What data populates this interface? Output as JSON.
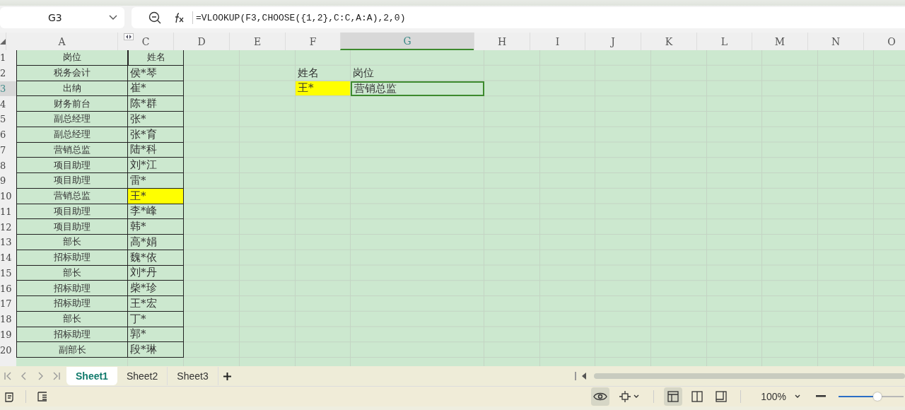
{
  "name_box": {
    "value": "G3"
  },
  "formula_bar": {
    "formula": "=VLOOKUP(F3,CHOOSE({1,2},C:C,A:A),2,0)"
  },
  "columns": [
    {
      "label": "A",
      "selected": false
    },
    {
      "label": "C",
      "selected": false
    },
    {
      "label": "D",
      "selected": false
    },
    {
      "label": "E",
      "selected": false
    },
    {
      "label": "F",
      "selected": false
    },
    {
      "label": "G",
      "selected": true
    },
    {
      "label": "H",
      "selected": false
    },
    {
      "label": "I",
      "selected": false
    },
    {
      "label": "J",
      "selected": false
    },
    {
      "label": "K",
      "selected": false
    },
    {
      "label": "L",
      "selected": false
    },
    {
      "label": "M",
      "selected": false
    },
    {
      "label": "N",
      "selected": false
    },
    {
      "label": "O",
      "selected": false
    }
  ],
  "rows": [
    {
      "number": "1",
      "selected": false,
      "cells": [
        {
          "text": "岗位",
          "kind": "table-center",
          "highlight": false,
          "selected": false
        },
        {
          "text": "姓名",
          "kind": "table-center",
          "highlight": false,
          "selected": false
        }
      ]
    },
    {
      "number": "2",
      "selected": false,
      "cells": [
        {
          "text": "税务会计",
          "kind": "table-center",
          "highlight": false,
          "selected": false
        },
        {
          "text": "侯*琴",
          "kind": "table-left",
          "highlight": false,
          "selected": false
        },
        {},
        {},
        {
          "text": "姓名",
          "kind": "plain",
          "highlight": false,
          "selected": false
        },
        {
          "text": "岗位",
          "kind": "plain",
          "highlight": false,
          "selected": false
        }
      ]
    },
    {
      "number": "3",
      "selected": true,
      "cells": [
        {
          "text": "出纳",
          "kind": "table-center",
          "highlight": false,
          "selected": false
        },
        {
          "text": "崔*",
          "kind": "table-left",
          "highlight": false,
          "selected": false
        },
        {},
        {},
        {
          "text": "王*",
          "kind": "plain",
          "highlight": true,
          "selected": false
        },
        {
          "text": "营销总监",
          "kind": "plain",
          "highlight": false,
          "selected": true
        }
      ]
    },
    {
      "number": "4",
      "selected": false,
      "cells": [
        {
          "text": "财务前台",
          "kind": "table-center",
          "highlight": false,
          "selected": false
        },
        {
          "text": "陈*群",
          "kind": "table-left",
          "highlight": false,
          "selected": false
        }
      ]
    },
    {
      "number": "5",
      "selected": false,
      "cells": [
        {
          "text": "副总经理",
          "kind": "table-center",
          "highlight": false,
          "selected": false
        },
        {
          "text": "张*",
          "kind": "table-left",
          "highlight": false,
          "selected": false
        }
      ]
    },
    {
      "number": "6",
      "selected": false,
      "cells": [
        {
          "text": "副总经理",
          "kind": "table-center",
          "highlight": false,
          "selected": false
        },
        {
          "text": "张*育",
          "kind": "table-left",
          "highlight": false,
          "selected": false
        }
      ]
    },
    {
      "number": "7",
      "selected": false,
      "cells": [
        {
          "text": "营销总监",
          "kind": "table-center",
          "highlight": false,
          "selected": false
        },
        {
          "text": "陆*科",
          "kind": "table-left",
          "highlight": false,
          "selected": false
        }
      ]
    },
    {
      "number": "8",
      "selected": false,
      "cells": [
        {
          "text": "项目助理",
          "kind": "table-center",
          "highlight": false,
          "selected": false
        },
        {
          "text": "刘*江",
          "kind": "table-left",
          "highlight": false,
          "selected": false
        }
      ]
    },
    {
      "number": "9",
      "selected": false,
      "cells": [
        {
          "text": "项目助理",
          "kind": "table-center",
          "highlight": false,
          "selected": false
        },
        {
          "text": "雷*",
          "kind": "table-left",
          "highlight": false,
          "selected": false
        }
      ]
    },
    {
      "number": "10",
      "selected": false,
      "cells": [
        {
          "text": "营销总监",
          "kind": "table-center",
          "highlight": false,
          "selected": false
        },
        {
          "text": "王*",
          "kind": "table-left",
          "highlight": true,
          "selected": false
        }
      ]
    },
    {
      "number": "11",
      "selected": false,
      "cells": [
        {
          "text": "项目助理",
          "kind": "table-center",
          "highlight": false,
          "selected": false
        },
        {
          "text": "李*峰",
          "kind": "table-left",
          "highlight": false,
          "selected": false
        }
      ]
    },
    {
      "number": "12",
      "selected": false,
      "cells": [
        {
          "text": "项目助理",
          "kind": "table-center",
          "highlight": false,
          "selected": false
        },
        {
          "text": "韩*",
          "kind": "table-left",
          "highlight": false,
          "selected": false
        }
      ]
    },
    {
      "number": "13",
      "selected": false,
      "cells": [
        {
          "text": "部长",
          "kind": "table-center",
          "highlight": false,
          "selected": false
        },
        {
          "text": "高*娟",
          "kind": "table-left",
          "highlight": false,
          "selected": false
        }
      ]
    },
    {
      "number": "14",
      "selected": false,
      "cells": [
        {
          "text": "招标助理",
          "kind": "table-center",
          "highlight": false,
          "selected": false
        },
        {
          "text": "魏*依",
          "kind": "table-left",
          "highlight": false,
          "selected": false
        }
      ]
    },
    {
      "number": "15",
      "selected": false,
      "cells": [
        {
          "text": "部长",
          "kind": "table-center",
          "highlight": false,
          "selected": false
        },
        {
          "text": "刘*丹",
          "kind": "table-left",
          "highlight": false,
          "selected": false
        }
      ]
    },
    {
      "number": "16",
      "selected": false,
      "cells": [
        {
          "text": "招标助理",
          "kind": "table-center",
          "highlight": false,
          "selected": false
        },
        {
          "text": "柴*珍",
          "kind": "table-left",
          "highlight": false,
          "selected": false
        }
      ]
    },
    {
      "number": "17",
      "selected": false,
      "cells": [
        {
          "text": "招标助理",
          "kind": "table-center",
          "highlight": false,
          "selected": false
        },
        {
          "text": "王*宏",
          "kind": "table-left",
          "highlight": false,
          "selected": false
        }
      ]
    },
    {
      "number": "18",
      "selected": false,
      "cells": [
        {
          "text": "部长",
          "kind": "table-center",
          "highlight": false,
          "selected": false
        },
        {
          "text": "丁*",
          "kind": "table-left",
          "highlight": false,
          "selected": false
        }
      ]
    },
    {
      "number": "19",
      "selected": false,
      "cells": [
        {
          "text": "招标助理",
          "kind": "table-center",
          "highlight": false,
          "selected": false
        },
        {
          "text": "郭*",
          "kind": "table-left",
          "highlight": false,
          "selected": false
        }
      ]
    },
    {
      "number": "20",
      "selected": false,
      "cells": [
        {
          "text": "副部长",
          "kind": "table-center",
          "highlight": false,
          "selected": false
        },
        {
          "text": "段*琳",
          "kind": "table-left",
          "highlight": false,
          "selected": false
        }
      ]
    }
  ],
  "sheet_tabs": [
    {
      "label": "Sheet1",
      "selected": true
    },
    {
      "label": "Sheet2",
      "selected": false
    },
    {
      "label": "Sheet3",
      "selected": false
    }
  ],
  "status_bar": {
    "zoom": "100%",
    "zoom_slider": {
      "level": 0.6
    },
    "eye_protection": {
      "on": true
    },
    "views": [
      {
        "kind": "normal",
        "selected": true
      },
      {
        "kind": "page-break",
        "selected": false
      },
      {
        "kind": "page-layout",
        "selected": false
      }
    ]
  }
}
